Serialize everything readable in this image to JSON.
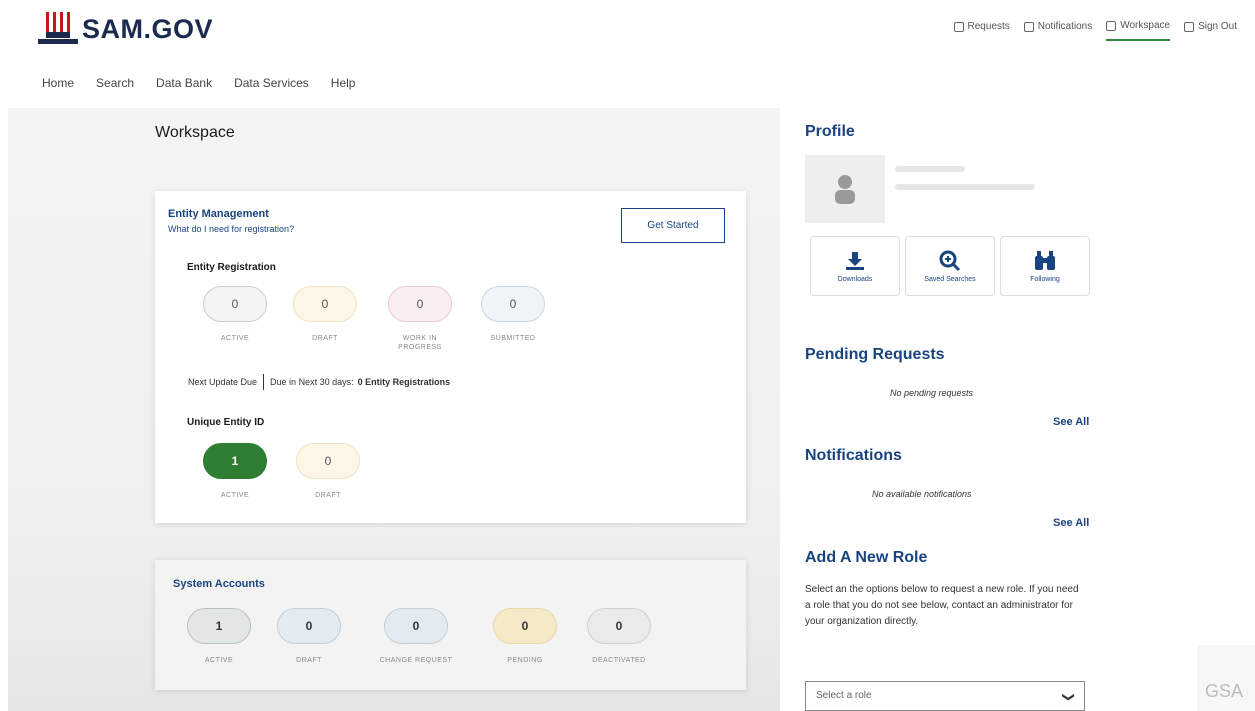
{
  "header": {
    "logo_text": "SAM.GOV",
    "util_nav": [
      {
        "label": "Requests",
        "icon": "document-icon"
      },
      {
        "label": "Notifications",
        "icon": "bell-icon"
      },
      {
        "label": "Workspace",
        "icon": "grid-icon"
      },
      {
        "label": "Sign Out",
        "icon": "signout-icon"
      }
    ]
  },
  "main_nav": [
    "Home",
    "Search",
    "Data Bank",
    "Data Services",
    "Help"
  ],
  "page_title": "Workspace",
  "entity_management": {
    "title": "Entity Management",
    "subtitle": "What do I need for registration?",
    "get_started": "Get Started",
    "entity_registration": {
      "title": "Entity Registration",
      "items": [
        {
          "count": "0",
          "label": "ACTIVE"
        },
        {
          "count": "0",
          "label": "DRAFT"
        },
        {
          "count": "0",
          "label": "WORK IN PROGRESS"
        },
        {
          "count": "0",
          "label": "SUBMITTED"
        }
      ]
    },
    "next_update": "Next Update Due",
    "due_text": "Due in Next 30 days:",
    "due_count": "0 Entity Registrations",
    "unique_entity": {
      "title": "Unique Entity ID",
      "items": [
        {
          "count": "1",
          "label": "ACTIVE"
        },
        {
          "count": "0",
          "label": "DRAFT"
        }
      ]
    }
  },
  "system_accounts": {
    "title": "System Accounts",
    "items": [
      {
        "count": "1",
        "label": "ACTIVE"
      },
      {
        "count": "0",
        "label": "DRAFT"
      },
      {
        "count": "0",
        "label": "CHANGE REQUEST"
      },
      {
        "count": "0",
        "label": "PENDING"
      },
      {
        "count": "0",
        "label": "DEACTIVATED"
      }
    ]
  },
  "profile": {
    "title": "Profile",
    "tiles": [
      {
        "label": "Downloads",
        "icon": "download-icon"
      },
      {
        "label": "Saved Searches",
        "icon": "magnifier-plus-icon"
      },
      {
        "label": "Following",
        "icon": "binoculars-icon"
      }
    ]
  },
  "pending": {
    "title": "Pending Requests",
    "empty": "No pending requests",
    "see_all": "See All"
  },
  "notifications": {
    "title": "Notifications",
    "empty": "No available notifications",
    "see_all": "See All"
  },
  "add_role": {
    "title": "Add A New Role",
    "text": "Select an the options below to request a new role. If you need a role that you do not see below, contact an administrator for your organization directly.",
    "select_placeholder": "Select a role"
  },
  "gsa_badge": "GSA",
  "colors": {
    "brand_blue": "#1a4480",
    "active_green": "#2e7d32",
    "accent_green": "#2e8540"
  }
}
